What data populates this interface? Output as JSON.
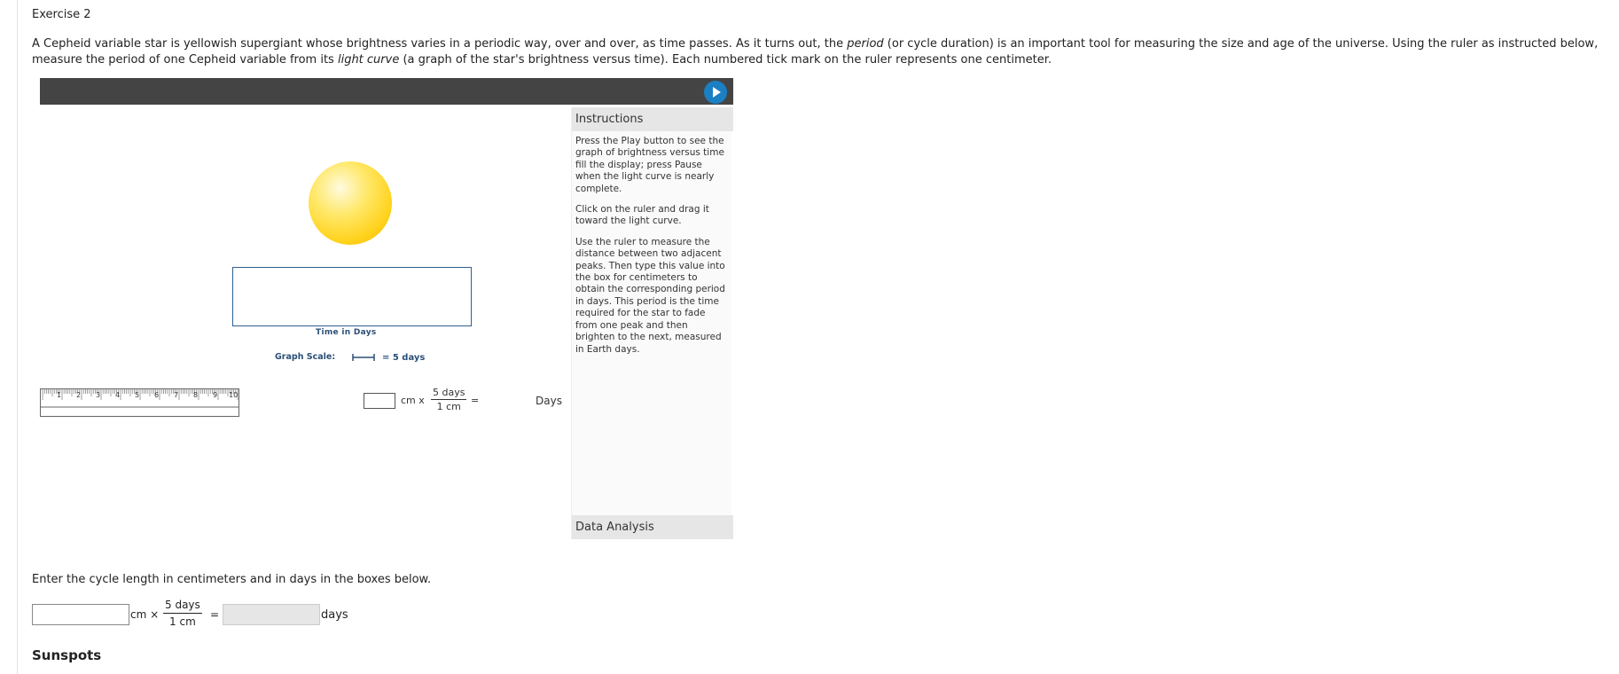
{
  "exercise_title": "Exercise 2",
  "intro": {
    "part1": "A Cepheid variable star is yellowish supergiant whose brightness varies in a periodic way, over and over, as time passes. As it turns out, the ",
    "period_word": "period",
    "part2": " (or cycle duration) is an important tool for measuring the size and age of the universe. Using the ruler as instructed below, measure the period of one Cepheid variable from its ",
    "light_curve_word": "light curve",
    "part3": " (a graph of the star's brightness versus time). Each numbered tick mark on the ruler represents one centimeter."
  },
  "sim": {
    "graph_xlabel": "Time in Days",
    "graph_scale_label": "Graph Scale:",
    "graph_scale_value": "= 5 days",
    "ruler_numbers": [
      "1",
      "2",
      "3",
      "4",
      "5",
      "6",
      "7",
      "8",
      "9",
      "10"
    ],
    "calc": {
      "cm": "cm x",
      "num": "5 days",
      "den": "1 cm",
      "eq": "=",
      "days": "Days"
    },
    "instructions": {
      "title": "Instructions",
      "paragraphs": [
        "Press the Play button to see the graph of brightness versus time fill the display; press Pause when the light curve is nearly complete.",
        "Click on the ruler and drag it toward the light curve.",
        "Use the ruler to measure the distance between two adjacent peaks. Then type this value into the box for centimeters to obtain the corresponding period in days. This period is the time required for the star to fade from one peak and then brighten to the next, measured in Earth days."
      ],
      "footer": "Data Analysis"
    },
    "colors": {
      "topbar": "#444444",
      "play": "#1b7fc4",
      "star": "#ffd21c",
      "graph_border": "#2f5f8f"
    }
  },
  "answer": {
    "prompt": "Enter the cycle length in centimeters and in days in the boxes below.",
    "cm_label": "cm ×",
    "frac_num": "5 days",
    "frac_den": "1 cm",
    "eq": "=",
    "days_label": "days",
    "cm_value": "",
    "days_value": ""
  },
  "next_section": "Sunspots"
}
